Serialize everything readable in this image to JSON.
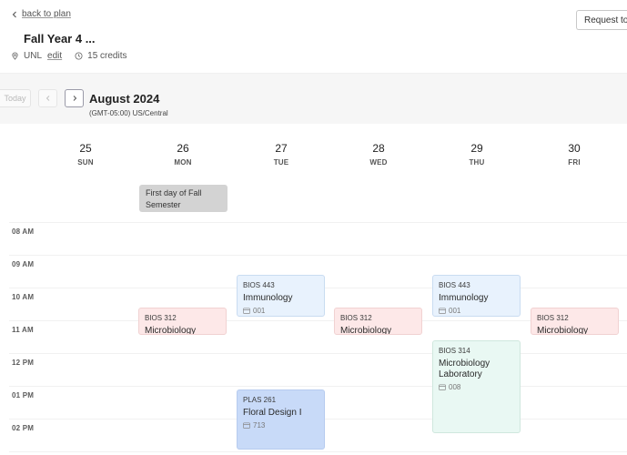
{
  "header": {
    "back_label": "back to plan",
    "plan_title": "Fall Year 4 ...",
    "school": "UNL",
    "edit_label": "edit",
    "credits": "15 credits",
    "request_button": "Request to Re"
  },
  "toolbar": {
    "today_label": "Today",
    "month_title": "August 2024",
    "timezone": "(GMT-05:00) US/Central"
  },
  "days": [
    {
      "num": "25",
      "dow": "SUN"
    },
    {
      "num": "26",
      "dow": "MON"
    },
    {
      "num": "27",
      "dow": "TUE"
    },
    {
      "num": "28",
      "dow": "WED"
    },
    {
      "num": "29",
      "dow": "THU"
    },
    {
      "num": "30",
      "dow": "FRI"
    }
  ],
  "all_day_events": [
    {
      "day": "MON",
      "title": "First day of Fall Semester"
    }
  ],
  "hours": [
    "08 AM",
    "09 AM",
    "10 AM",
    "11 AM",
    "12 PM",
    "01 PM",
    "02 PM"
  ],
  "events": [
    {
      "day": "TUE",
      "code": "BIOS 443",
      "name": "Immunology",
      "section": "001",
      "color": "#e8f2fd"
    },
    {
      "day": "THU",
      "code": "BIOS 443",
      "name": "Immunology",
      "section": "001",
      "color": "#e8f2fd"
    },
    {
      "day": "MON",
      "code": "BIOS 312",
      "name": "Microbiology",
      "color": "#fde8e8"
    },
    {
      "day": "WED",
      "code": "BIOS 312",
      "name": "Microbiology",
      "color": "#fde8e8"
    },
    {
      "day": "FRI",
      "code": "BIOS 312",
      "name": "Microbiology",
      "color": "#fde8e8"
    },
    {
      "day": "THU",
      "code": "BIOS 314",
      "name": "Microbiology Laboratory",
      "section": "008",
      "color": "#e9f8f3"
    },
    {
      "day": "TUE",
      "code": "PLAS 261",
      "name": "Floral Design I",
      "section": "713",
      "color": "#c8daf8"
    }
  ]
}
